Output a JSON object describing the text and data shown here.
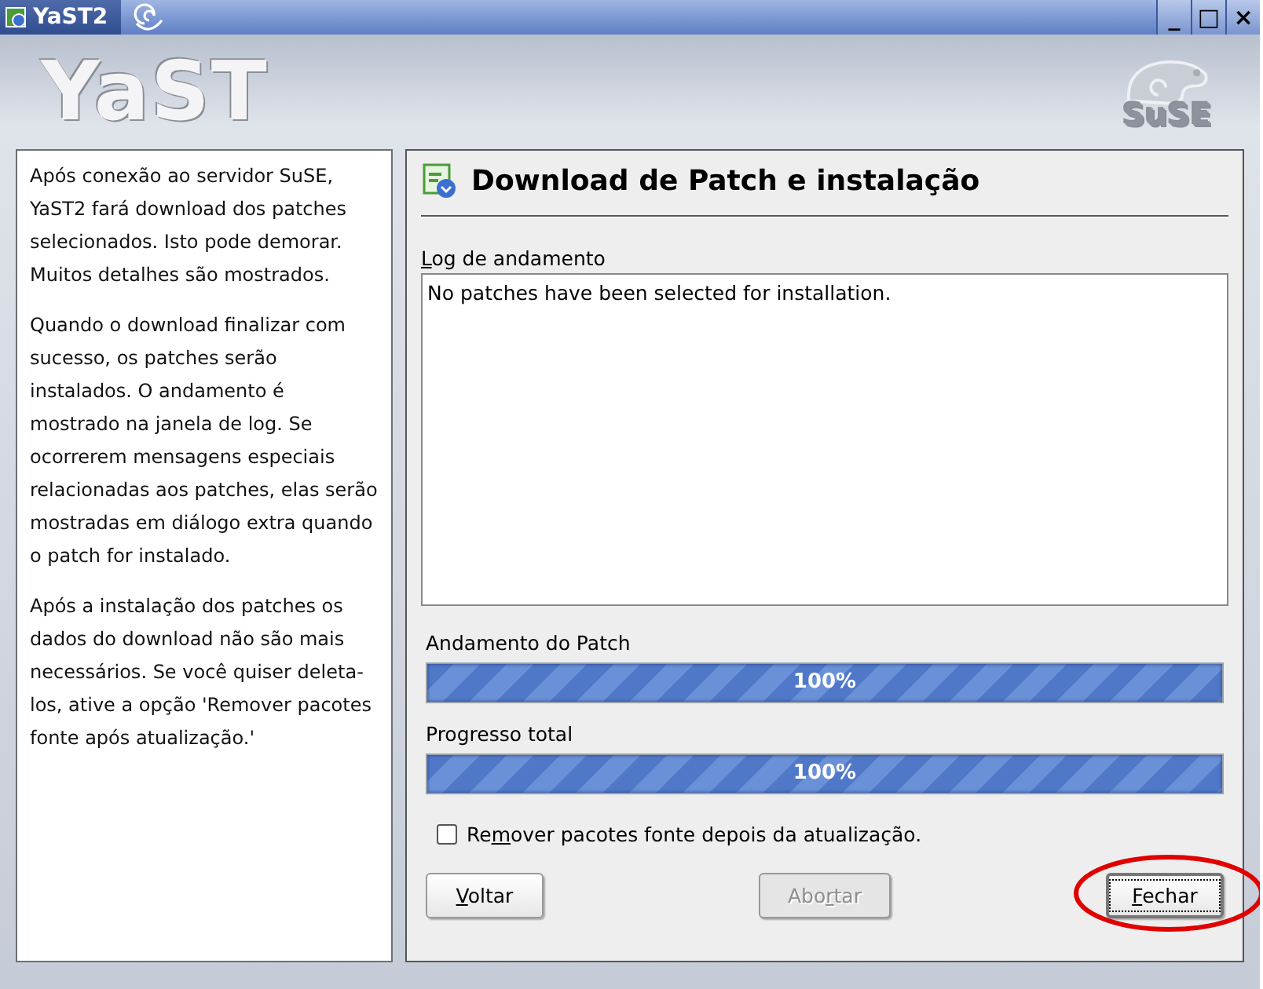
{
  "window": {
    "title": "YaST2",
    "controls": [
      "_",
      "□",
      "×"
    ]
  },
  "header": {
    "logo": "YaST",
    "brand": "SuSE"
  },
  "help": [
    "Após conexão ao servidor SuSE, YaST2 fará download dos patches selecionados. Isto pode demorar. Muitos detalhes são mostrados.",
    "Quando o download finalizar com sucesso, os patches serão instalados. O andamento é mostrado na janela de log. Se ocorrerem mensagens especiais relacionadas aos patches, elas serão mostradas em diálogo extra quando o patch for instalado.",
    "Após a instalação dos patches os dados do download não são mais necessários. Se você quiser deleta-los, ative a opção 'Remover pacotes fonte após atualização.'"
  ],
  "dialog": {
    "title": "Download de Patch e instalação",
    "log": {
      "label": {
        "key": "L",
        "post": "og de andamento"
      },
      "lines": [
        "No patches have been selected for installation."
      ]
    },
    "progress": [
      {
        "label": "Andamento do Patch",
        "level": 1,
        "reading": "100%"
      },
      {
        "label": "Progresso total",
        "level": 1,
        "reading": "100%"
      }
    ],
    "checkbox": {
      "label": {
        "pre": "Re",
        "key": "m",
        "post": "over pacotes fonte depois da atualização."
      },
      "checked": false
    },
    "buttons": [
      {
        "label": {
          "key": "V",
          "post": "oltar"
        },
        "disabled": false,
        "focused": false,
        "highlighted": false
      },
      {
        "label": {
          "pre": "Abo",
          "key": "r",
          "post": "tar"
        },
        "disabled": true,
        "focused": false,
        "highlighted": false
      },
      {
        "label": {
          "key": "F",
          "post": "echar"
        },
        "disabled": false,
        "focused": true,
        "highlighted": true
      }
    ]
  }
}
